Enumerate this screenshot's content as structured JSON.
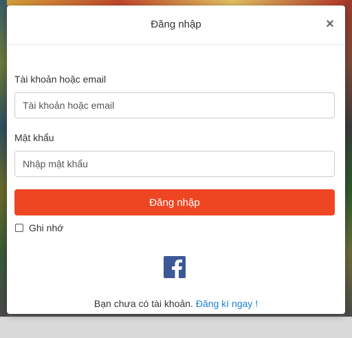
{
  "modal": {
    "title": "Đăng nhập",
    "close_label": "×"
  },
  "form": {
    "username_label": "Tài khoản hoặc email",
    "username_placeholder": "Tài khoản hoặc email",
    "username_value": "",
    "password_label": "Mật khẩu",
    "password_placeholder": "Nhập mật khẩu",
    "password_value": "",
    "submit_label": "Đăng nhập",
    "remember_label": "Ghi nhớ",
    "remember_checked": false
  },
  "social": {
    "facebook_icon": "facebook-icon"
  },
  "register": {
    "prompt": "Bạn chưa có tài khoản.",
    "link_label": "Đăng kí ngay !"
  },
  "colors": {
    "primary": "#ee4623",
    "link": "#1a7fd4",
    "facebook": "#3b5998"
  }
}
